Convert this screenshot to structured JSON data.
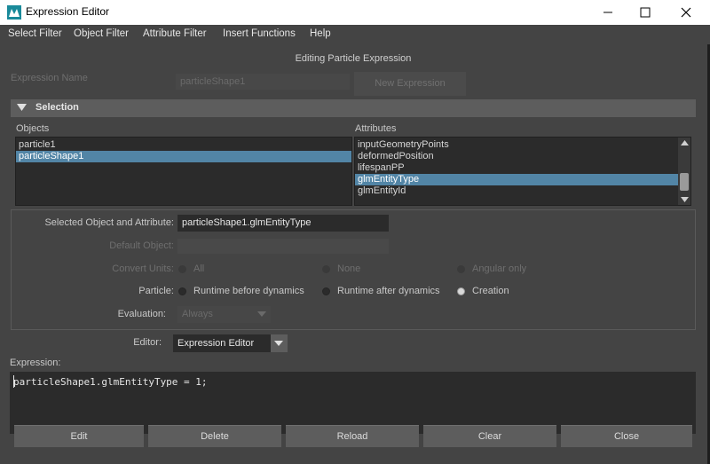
{
  "window": {
    "title": "Expression Editor"
  },
  "menu": [
    "Select Filter",
    "Object Filter",
    "Attribute Filter",
    "Insert Functions",
    "Help"
  ],
  "header": "Editing Particle Expression",
  "expression_name": {
    "label": "Expression Name",
    "value": "particleShape1",
    "new_button": "New Expression"
  },
  "selection": {
    "title": "Selection",
    "objects_label": "Objects",
    "objects": [
      "particle1",
      "particleShape1"
    ],
    "objects_selected": "particleShape1",
    "attributes_label": "Attributes",
    "attributes": [
      "inputGeometryPoints",
      "deformedPosition",
      "lifespanPP",
      "glmEntityType",
      "glmEntityId"
    ],
    "attributes_selected": "glmEntityType"
  },
  "form": {
    "selected_label": "Selected Object and Attribute:",
    "selected_value": "particleShape1.glmEntityType",
    "default_label": "Default Object:",
    "default_value": "",
    "convert_label": "Convert Units:",
    "convert_options": [
      "All",
      "None",
      "Angular only"
    ],
    "particle_label": "Particle:",
    "particle_options": [
      "Runtime before dynamics",
      "Runtime after dynamics",
      "Creation"
    ],
    "particle_selected": "Creation",
    "evaluation_label": "Evaluation:",
    "evaluation_value": "Always"
  },
  "editor": {
    "label": "Editor:",
    "value": "Expression Editor"
  },
  "expression": {
    "label": "Expression:",
    "text": "particleShape1.glmEntityType = 1;"
  },
  "buttons": [
    "Edit",
    "Delete",
    "Reload",
    "Clear",
    "Close"
  ],
  "colors": {
    "selection_highlight": "#5285a6",
    "background": "#444444",
    "field": "#2b2b2b"
  }
}
